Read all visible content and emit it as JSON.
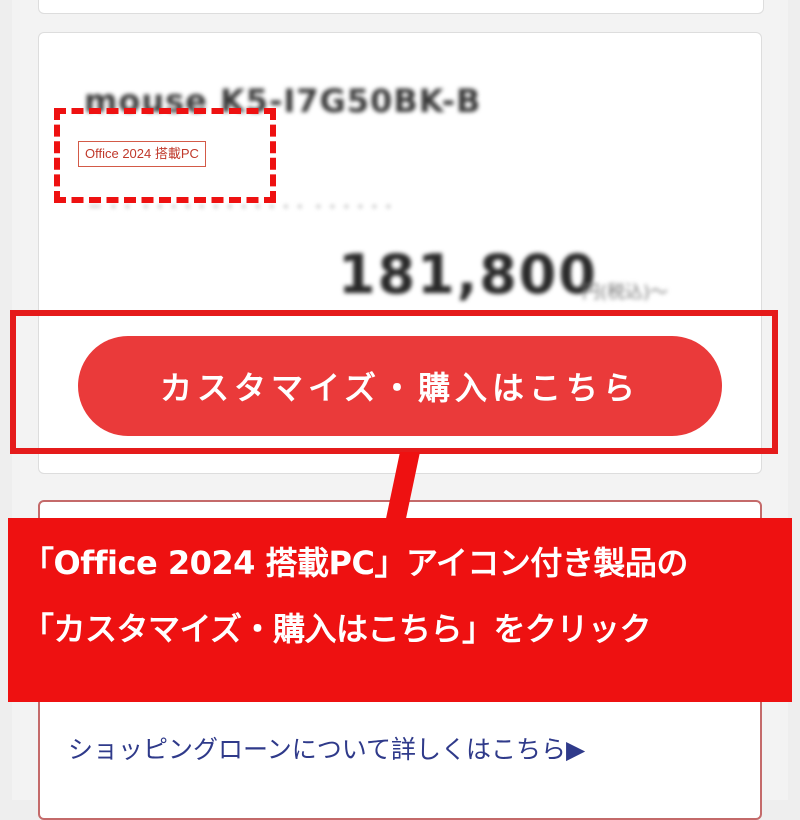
{
  "product": {
    "model_name": "mouse K5-I7G50BK-B",
    "badge_label": "Office 2024 搭載PC",
    "sub_line": "ー ・・ ・・・・・・・・・・・・ ・・・・・・",
    "price": "181,800",
    "price_unit": "円(税込)〜"
  },
  "cta": {
    "customize_label": "カスタマイズ・購入はこちら"
  },
  "loan": {
    "link_label": "ショッピングローンについて詳しくはこちら",
    "arrow": "▶"
  },
  "callout": {
    "line1": "「Office 2024 搭載PC」アイコン付き製品の",
    "line2": "「カスタマイズ・購入はこちら」をクリック"
  },
  "colors": {
    "annotation_red": "#ee1111",
    "button_red": "#ea3a3a",
    "link_navy": "#2f3a8a",
    "badge_border": "#d35a48"
  }
}
